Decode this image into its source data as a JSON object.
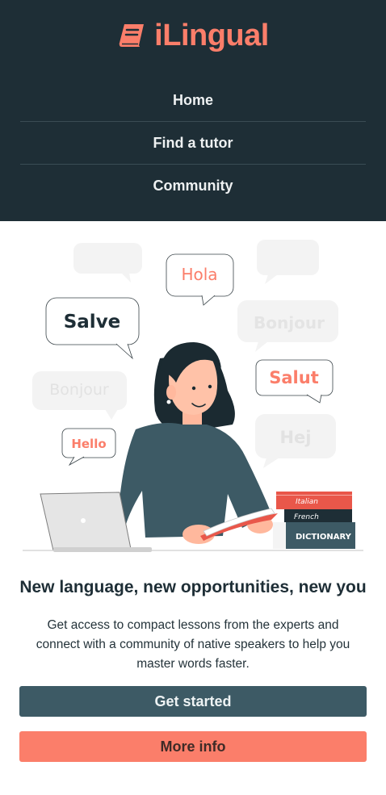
{
  "brand": {
    "name": "iLingual",
    "icon": "book-icon",
    "color": "#fb7e6a"
  },
  "nav": {
    "items": [
      {
        "label": "Home"
      },
      {
        "label": "Find a tutor"
      },
      {
        "label": "Community"
      }
    ]
  },
  "illustration": {
    "bubbles": {
      "hola": "Hola",
      "salve": "Salve",
      "bonjour_right": "Bonjour",
      "salut": "Salut",
      "bonjour_left": "Bonjour",
      "hej": "Hej",
      "hello": "Hello"
    },
    "books": {
      "italian": "Italian",
      "french": "French",
      "dictionary": "DICTIONARY"
    }
  },
  "hero": {
    "headline": "New language, new opportunities, new you",
    "description": "Get access to compact lessons from the experts and connect with a community of native speakers to help you master words faster."
  },
  "actions": {
    "primary_label": "Get started",
    "secondary_label": "More info"
  },
  "colors": {
    "header_bg": "#1e2e36",
    "accent": "#fb7e6a",
    "primary_button": "#3d5a65"
  }
}
